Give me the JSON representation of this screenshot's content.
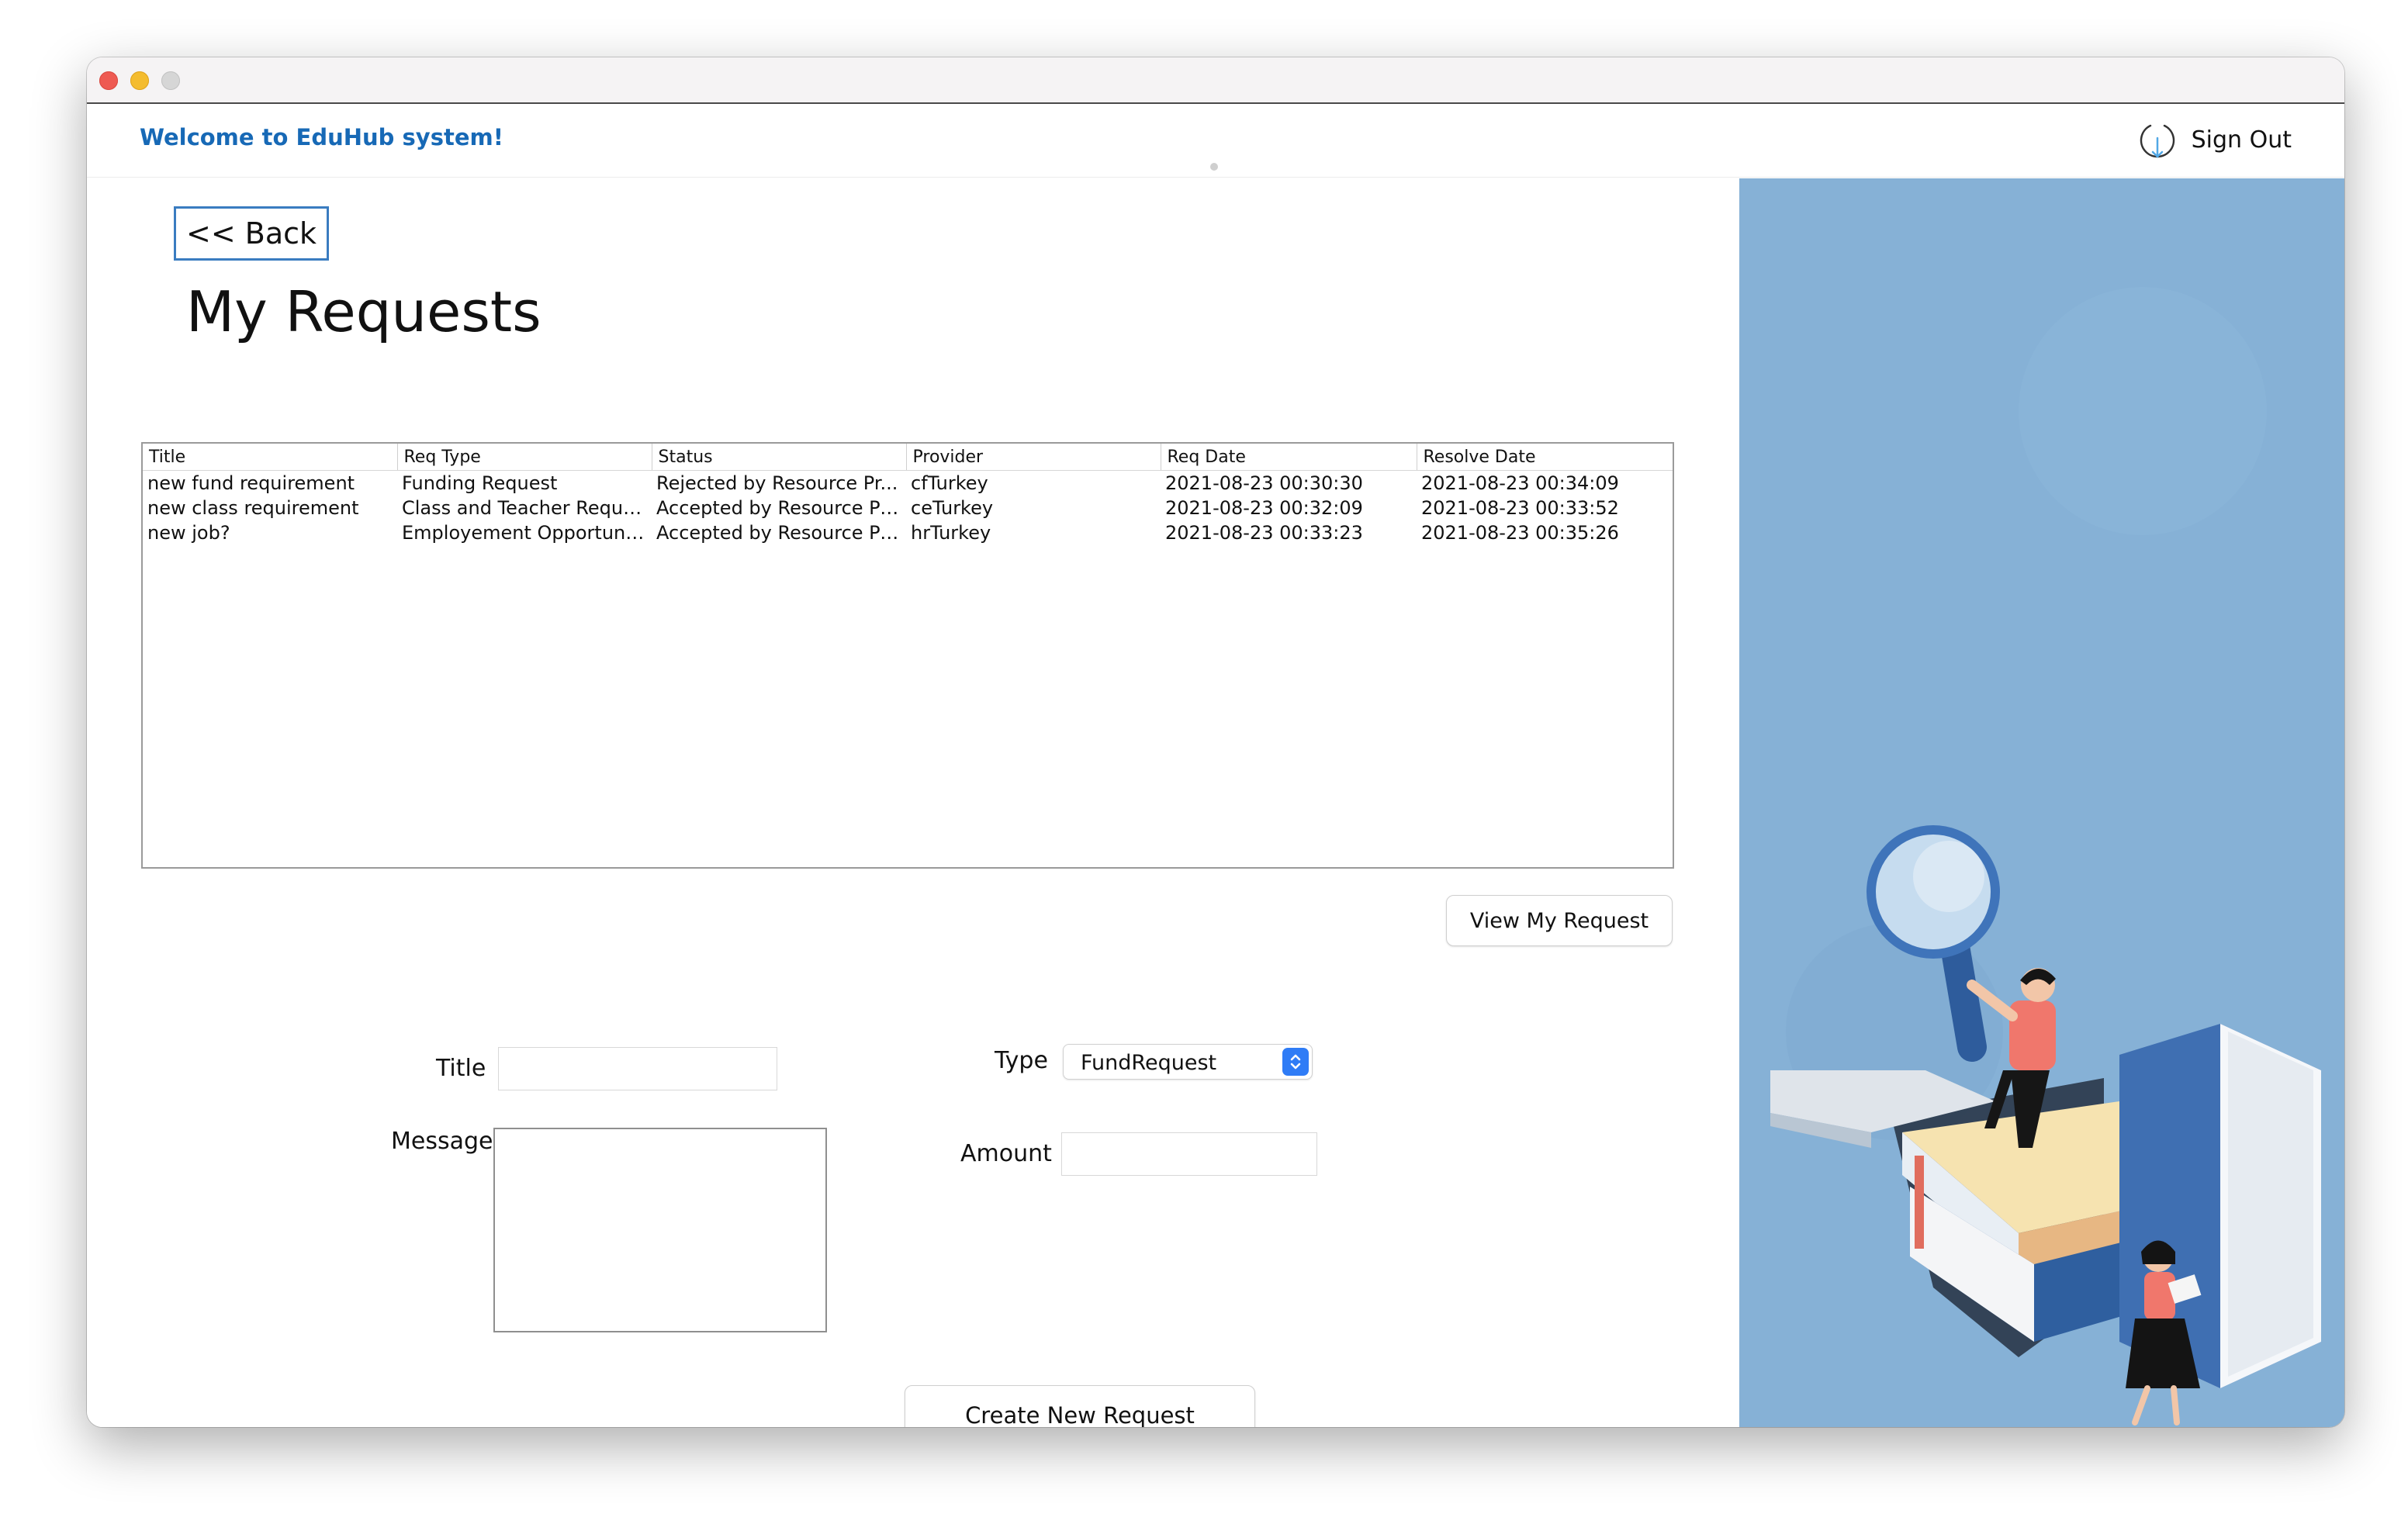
{
  "header": {
    "welcome": "Welcome to EduHub system!",
    "sign_out": "Sign Out"
  },
  "nav": {
    "back_label": "<< Back"
  },
  "page": {
    "title": "My Requests"
  },
  "table": {
    "columns": [
      "Title",
      "Req Type",
      "Status",
      "Provider",
      "Req Date",
      "Resolve Date"
    ],
    "rows": [
      [
        "new fund requirement",
        "Funding Request",
        "Rejected by Resource Pr...",
        "cfTurkey",
        "2021-08-23 00:30:30",
        "2021-08-23 00:34:09"
      ],
      [
        "new class requirement",
        "Class and Teacher Request",
        "Accepted by Resource Pr...",
        "ceTurkey",
        "2021-08-23 00:32:09",
        "2021-08-23 00:33:52"
      ],
      [
        "new job?",
        "Employement Opportunit...",
        "Accepted by Resource Pr...",
        "hrTurkey",
        "2021-08-23 00:33:23",
        "2021-08-23 00:35:26"
      ]
    ]
  },
  "actions": {
    "view_request": "View My Request",
    "create_request": "Create New Request"
  },
  "form": {
    "title_label": "Title",
    "title_value": "",
    "message_label": "Message",
    "message_value": "",
    "type_label": "Type",
    "type_selected": "FundRequest",
    "amount_label": "Amount",
    "amount_value": ""
  },
  "colors": {
    "accent": "#1769b6",
    "side_panel": "#86b1d6",
    "select_arrow": "#2f7cf6"
  },
  "icons": {
    "sign_out": "power-download-icon",
    "select": "chevron-up-down-icon"
  }
}
